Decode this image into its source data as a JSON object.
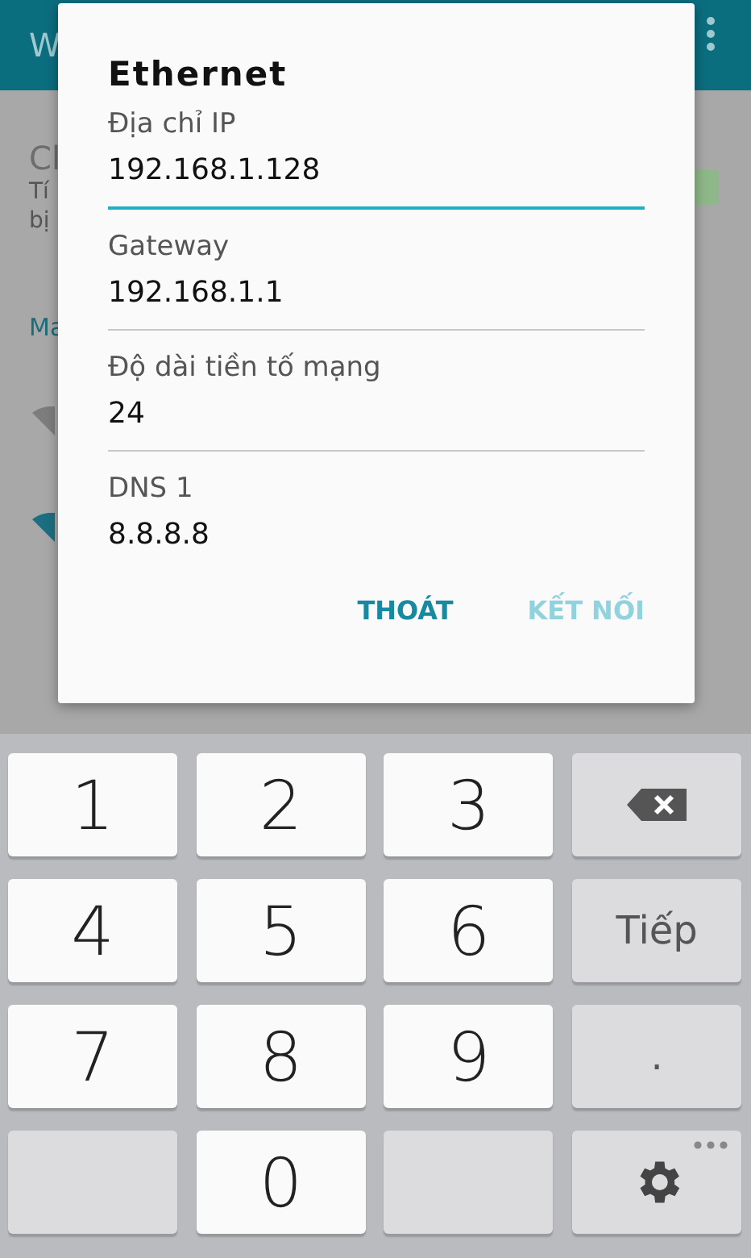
{
  "app_bar": {
    "title": "W"
  },
  "background": {
    "item_title": "Cl",
    "item_summary_lines": [
      "Tí",
      "bị"
    ],
    "checkbox": {
      "checked": true
    },
    "section_header": "Ma"
  },
  "dialog": {
    "title": "Ethernet",
    "fields": [
      {
        "label": "Địa chỉ IP",
        "value": "192.168.1.128",
        "focused": true
      },
      {
        "label": "Gateway",
        "value": "192.168.1.1",
        "focused": false
      },
      {
        "label": "Độ dài tiền tố mạng",
        "value": "24",
        "focused": false
      },
      {
        "label": "DNS 1",
        "value": "8.8.8.8",
        "focused": false
      }
    ],
    "buttons": [
      {
        "label": "THOÁT",
        "disabled": false
      },
      {
        "label": "KẾT NỐI",
        "disabled": true
      }
    ]
  },
  "keyboard": {
    "keys": [
      {
        "kind": "digit",
        "label": "1"
      },
      {
        "kind": "digit",
        "label": "2"
      },
      {
        "kind": "digit",
        "label": "3"
      },
      {
        "kind": "backspace"
      },
      {
        "kind": "digit",
        "label": "4"
      },
      {
        "kind": "digit",
        "label": "5"
      },
      {
        "kind": "digit",
        "label": "6"
      },
      {
        "kind": "action",
        "label": "Tiếp"
      },
      {
        "kind": "digit",
        "label": "7"
      },
      {
        "kind": "digit",
        "label": "8"
      },
      {
        "kind": "digit",
        "label": "9"
      },
      {
        "kind": "action",
        "label": "."
      },
      {
        "kind": "blank"
      },
      {
        "kind": "digit",
        "label": "0"
      },
      {
        "kind": "blank"
      },
      {
        "kind": "settings"
      }
    ]
  }
}
